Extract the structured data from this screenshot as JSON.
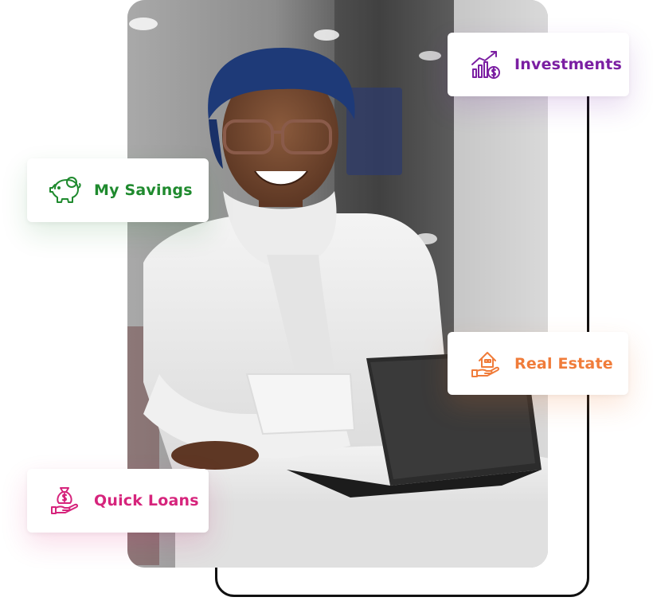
{
  "features": {
    "investments": {
      "label": "Investments",
      "color": "#7b1fa2",
      "icon": "growth-chart-dollar-icon"
    },
    "savings": {
      "label": "My Savings",
      "color": "#1f8a2e",
      "icon": "piggy-bank-icon"
    },
    "real_estate": {
      "label": "Real Estate",
      "color": "#f07c3a",
      "icon": "house-in-hand-icon"
    },
    "loans": {
      "label": "Quick Loans",
      "color": "#d6247c",
      "icon": "money-bag-hand-icon"
    }
  },
  "photo": {
    "subject": "person-with-tablet"
  }
}
